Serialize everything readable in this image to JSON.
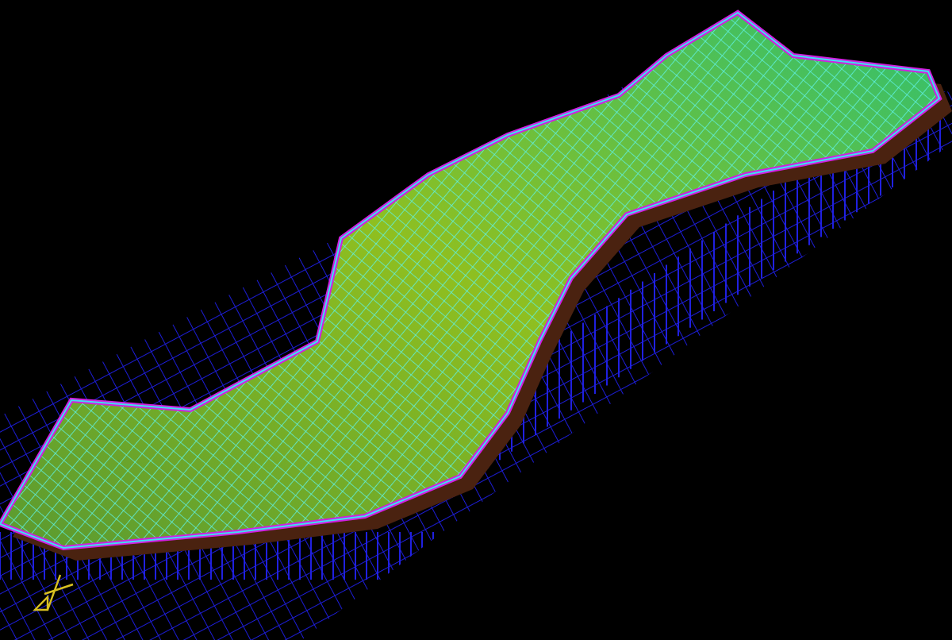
{
  "scene": {
    "kind": "wireframe-terrain"
  }
}
